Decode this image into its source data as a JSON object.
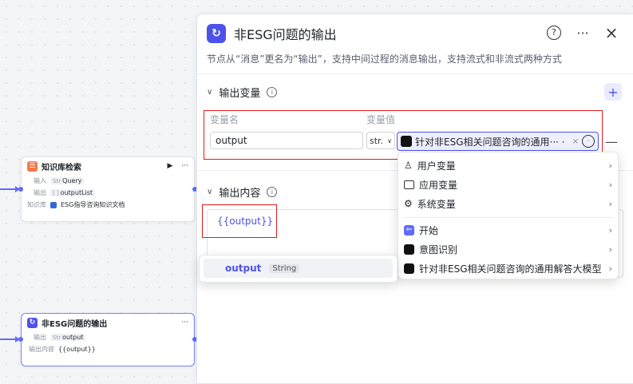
{
  "canvas": {
    "node_kb": {
      "title": "知识库检索",
      "rows": [
        {
          "label": "输入",
          "type": "Str",
          "value": "Query"
        },
        {
          "label": "输出",
          "type": "[ ]",
          "value": "outputList"
        },
        {
          "label": "知识库",
          "value": "ESG指导咨询知识文档"
        }
      ]
    },
    "node_out": {
      "title": "非ESG问题的输出",
      "rows": [
        {
          "label": "输出",
          "type": "Str",
          "value": "output"
        },
        {
          "label": "输出内容",
          "value": "{{output}}"
        }
      ]
    }
  },
  "panel": {
    "title": "非ESG问题的输出",
    "description": "节点从“消息”更名为“输出”，支持中间过程的消息输出，支持流式和非流式两种方式",
    "header_buttons": {
      "help": "?",
      "more": "···",
      "close": "×"
    },
    "output_vars": {
      "section_title": "输出变量",
      "col_name": "变量名",
      "col_value": "变量值",
      "name_value": "output",
      "type_value": "str.",
      "selected_var": "针对非ESG相关问题咨询的通用··· ·",
      "add_label": "+",
      "remove_label": "—"
    },
    "output_content": {
      "section_title": "输出内容",
      "template": "{{output}}"
    }
  },
  "var_dropdown": {
    "items": [
      {
        "icon": "user-icon",
        "label": "用户变量"
      },
      {
        "icon": "folder-icon",
        "label": "应用变量"
      },
      {
        "icon": "gear-icon",
        "label": "系统变量"
      },
      {
        "icon": "start-icon",
        "label": "开始"
      },
      {
        "icon": "bot-icon",
        "label": "意图识别"
      },
      {
        "icon": "bot-icon",
        "label": "针对非ESG相关问题咨询的通用解答大模型"
      }
    ]
  },
  "suggestion": {
    "name": "output",
    "type": "String"
  },
  "colors": {
    "accent": "#4d53e8",
    "highlight": "#e01b1b",
    "edge": "#5f6bff"
  }
}
